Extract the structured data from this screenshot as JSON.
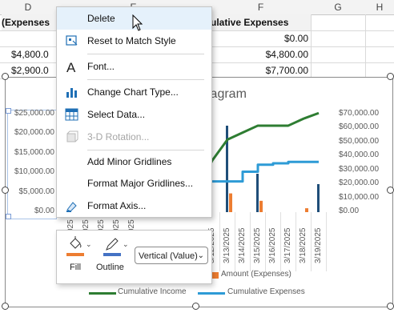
{
  "sheet": {
    "columns": [
      "D",
      "E",
      "F",
      "G",
      "H"
    ],
    "header_row": {
      "d": "(Expenses",
      "f": "ulative Expenses"
    },
    "rows": [
      {
        "d": "",
        "f": "$0.00"
      },
      {
        "d": "$4,800.0",
        "f": "$4,800.00"
      },
      {
        "d": "$2,900.0",
        "f": "$7,700.00"
      }
    ]
  },
  "context_menu": {
    "items": [
      {
        "label": "Delete",
        "icon": "none",
        "enabled": true,
        "hovered": true
      },
      {
        "label": "Reset to Match Style",
        "icon": "reset-style-icon",
        "enabled": true
      },
      {
        "label": "Font...",
        "icon": "font-icon",
        "enabled": true
      },
      {
        "label": "Change Chart Type...",
        "icon": "chart-type-icon",
        "enabled": true
      },
      {
        "label": "Select Data...",
        "icon": "select-data-icon",
        "enabled": true
      },
      {
        "label": "3-D Rotation...",
        "icon": "rotation-3d-icon",
        "enabled": false
      },
      {
        "label": "Add Minor Gridlines",
        "icon": "none",
        "enabled": true
      },
      {
        "label": "Format Major Gridlines...",
        "icon": "none",
        "enabled": true
      },
      {
        "label": "Format Axis...",
        "icon": "format-axis-icon",
        "enabled": true
      }
    ]
  },
  "mini_toolbar": {
    "fill_label": "Fill",
    "outline_label": "Outline",
    "selector_value": "Vertical (Value)",
    "fill_color": "#ed7d31",
    "outline_color": "#4472c4"
  },
  "chart": {
    "title_fragment": "iagram",
    "legend": {
      "amount": "Amount (Expenses)",
      "cum_income": "Cumulative Income",
      "cum_expenses": "Cumulative Expenses"
    },
    "colors": {
      "income": "#2e7d32",
      "expenses": "#2e9bd6",
      "amount": "#ed7d31",
      "navy": "#1f4e79"
    }
  },
  "chart_data": {
    "type": "line",
    "left_axis": {
      "ticks": [
        "$25,000.00",
        "$20,000.00",
        "$15,000.00",
        "$10,000.00",
        "$5,000.00",
        "$0.00"
      ],
      "ylim": [
        0,
        25000
      ]
    },
    "right_axis": {
      "ticks": [
        "$70,000.00",
        "$60,000.00",
        "$50,000.00",
        "$40,000.00",
        "$30,000.00",
        "$20,000.00",
        "$10,000.00",
        "$0.00"
      ],
      "ylim": [
        0,
        70000
      ]
    },
    "categories": [
      "3/12/2025",
      "3/13/2025",
      "3/14/2025",
      "3/15/2025",
      "3/16/2025",
      "3/17/2025",
      "3/18/2025",
      "3/19/2025"
    ],
    "partial_category_fragments": [
      "025",
      "025",
      "025",
      "025",
      "025"
    ],
    "series": [
      {
        "name": "Cumulative Income",
        "axis": "right",
        "values": [
          37000,
          52000,
          57000,
          62000,
          62000,
          62000,
          67000,
          71000
        ]
      },
      {
        "name": "Cumulative Expenses",
        "axis": "right",
        "values": [
          22000,
          22000,
          29000,
          34000,
          35000,
          36000,
          36000,
          36000
        ]
      },
      {
        "name": "Amount (Expenses)",
        "axis": "left",
        "type": "bar",
        "values": [
          null,
          4800,
          null,
          2900,
          null,
          null,
          1000,
          null
        ]
      }
    ]
  }
}
